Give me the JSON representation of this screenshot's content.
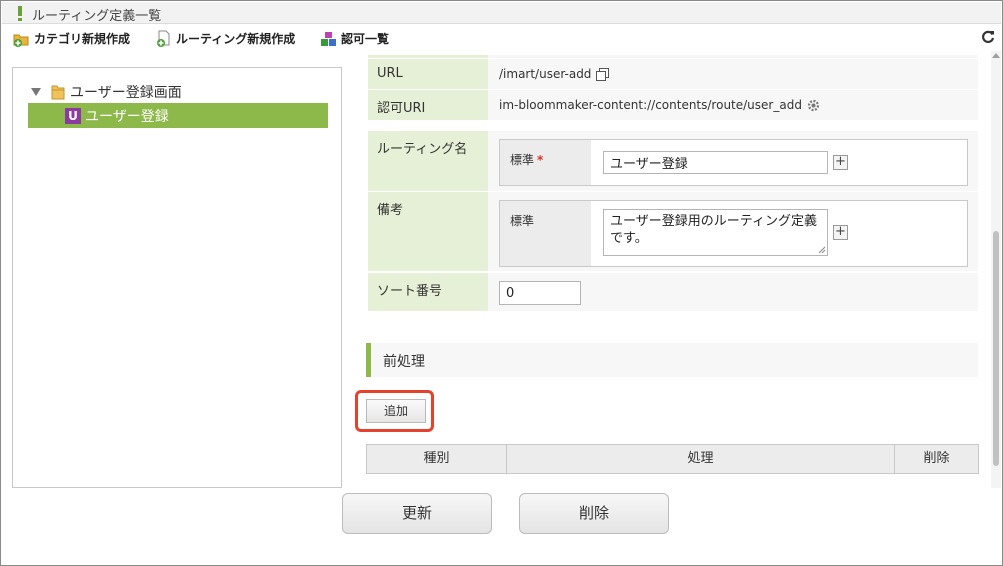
{
  "window": {
    "title": "ルーティング定義一覧"
  },
  "toolbar": {
    "items": [
      {
        "label": "カテゴリ新規作成",
        "icon": "add-category-icon"
      },
      {
        "label": "ルーティング新規作成",
        "icon": "add-routing-icon"
      },
      {
        "label": "認可一覧",
        "icon": "authorization-list-icon"
      }
    ],
    "refresh_icon": "refresh-icon"
  },
  "tree": {
    "root": {
      "label": "ユーザー登録画面"
    },
    "child": {
      "badge": "U",
      "label": "ユーザー登録"
    }
  },
  "form": {
    "url": {
      "label": "URL",
      "value": "/imart/user-add"
    },
    "auth_uri": {
      "label": "認可URI",
      "value": "im-bloommaker-content://contents/route/user_add"
    },
    "routing_name": {
      "label": "ルーティング名",
      "locale_label": "標準",
      "required_mark": "*",
      "value": "ユーザー登録"
    },
    "remarks": {
      "label": "備考",
      "locale_label": "標準",
      "value": "ユーザー登録用のルーティング定義です。"
    },
    "sort_number": {
      "label": "ソート番号",
      "value": "0"
    }
  },
  "preprocess": {
    "title": "前処理",
    "add_label": "追加",
    "columns": [
      "種別",
      "処理",
      "削除"
    ]
  },
  "footer": {
    "update_label": "更新",
    "delete_label": "削除"
  },
  "colors": {
    "accent_green": "#8db84a",
    "label_bg": "#e6f0d6",
    "highlight_red": "#e5412d",
    "badge_purple": "#8b3a9f"
  }
}
